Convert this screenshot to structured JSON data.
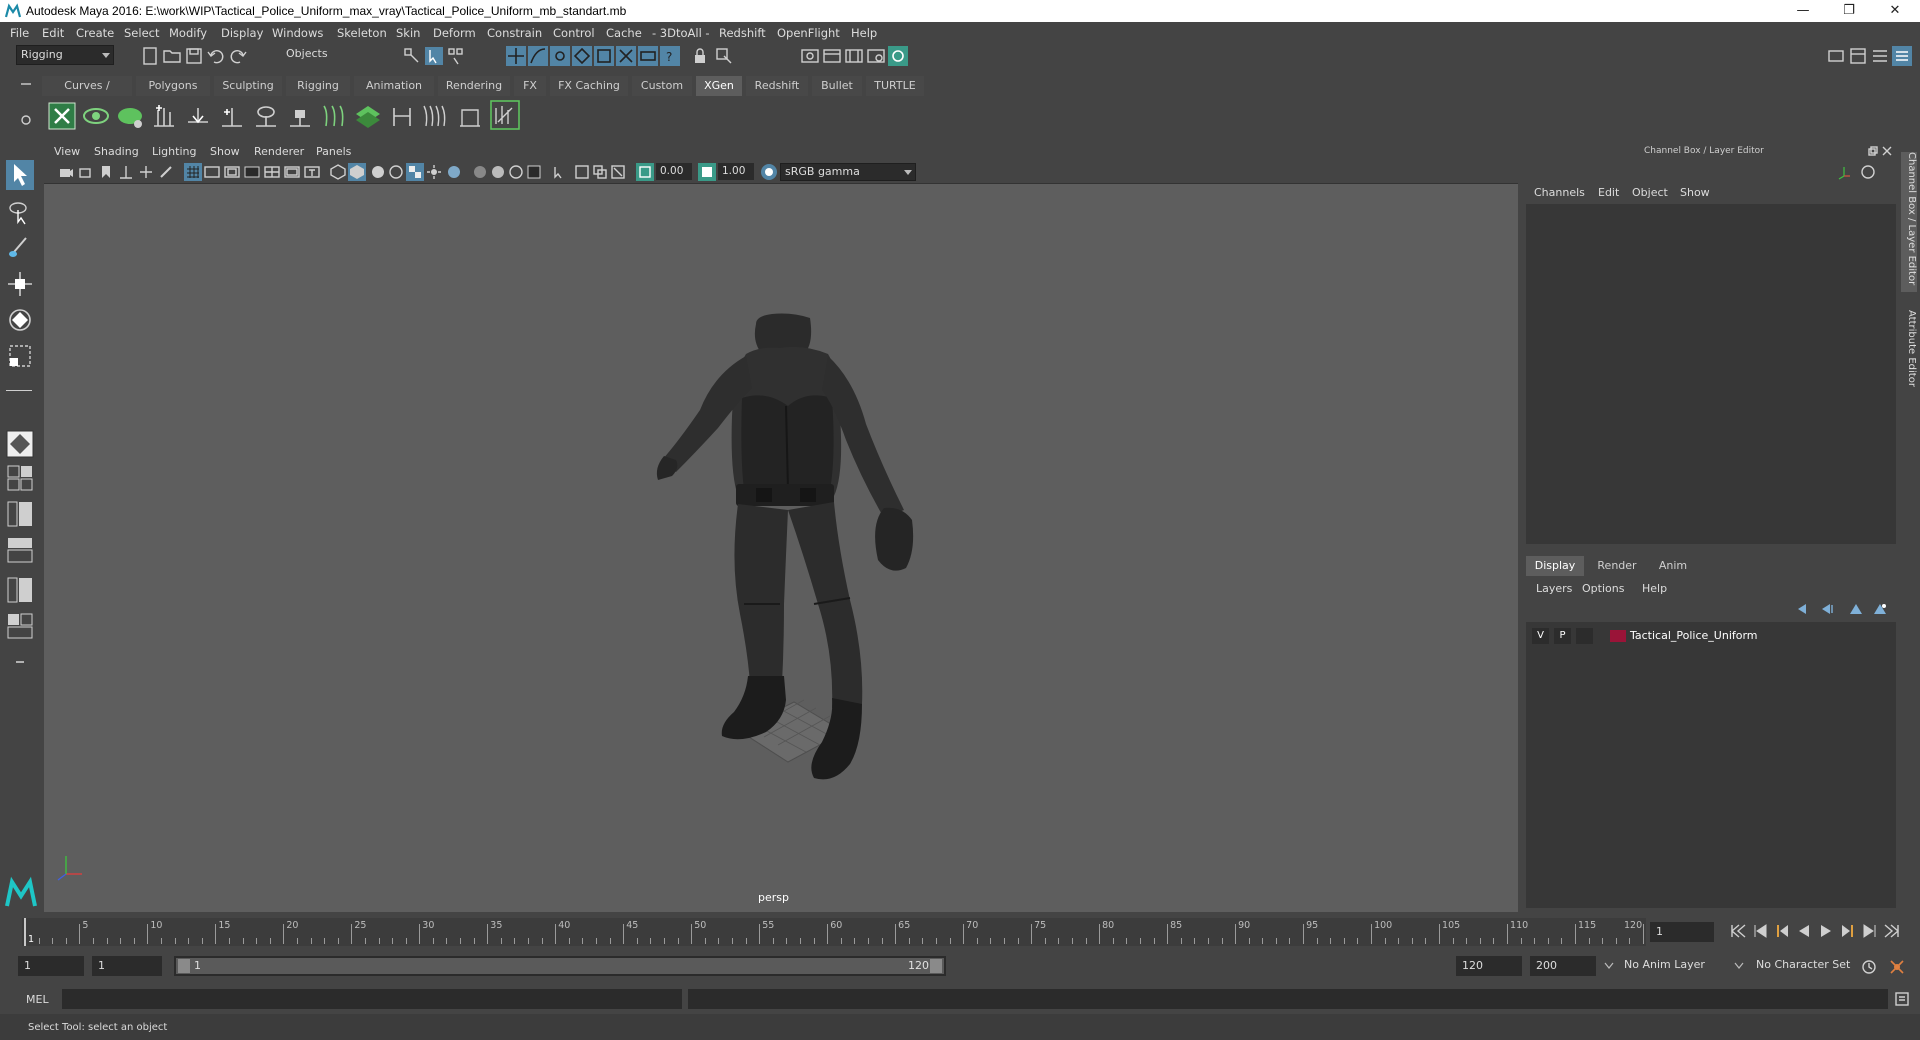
{
  "window": {
    "title": "Autodesk Maya 2016: E:\\work\\WIP\\Tactical_Police_Uniform_max_vray\\Tactical_Police_Uniform_mb_standart.mb",
    "minimize": "—",
    "restore": "❐",
    "close": "✕"
  },
  "menubar": {
    "items": [
      "File",
      "Edit",
      "Create",
      "Select",
      "Modify",
      "Display",
      "Windows",
      "Skeleton",
      "Skin",
      "Deform",
      "Constrain",
      "Control",
      "Cache",
      "- 3DtoAll -",
      "Redshift",
      "OpenFlight",
      "Help"
    ]
  },
  "statusline": {
    "menuset": "Rigging",
    "selection_mode": "Objects"
  },
  "shelf": {
    "tabs": [
      "Curves / Surfaces",
      "Polygons",
      "Sculpting",
      "Rigging",
      "Animation",
      "Rendering",
      "FX",
      "FX Caching",
      "Custom",
      "XGen",
      "Redshift",
      "Bullet",
      "TURTLE"
    ],
    "active_tab": "XGen"
  },
  "viewport": {
    "menu": [
      "View",
      "Shading",
      "Lighting",
      "Show",
      "Renderer",
      "Panels"
    ],
    "exposure": "0.00",
    "gamma": "1.00",
    "color_space": "sRGB gamma",
    "camera": "persp"
  },
  "channelbox": {
    "header": "Channel Box / Layer Editor",
    "menu": [
      "Channels",
      "Edit",
      "Object",
      "Show"
    ]
  },
  "layers": {
    "tabs": [
      "Display",
      "Render",
      "Anim"
    ],
    "active_tab": "Display",
    "menu": [
      "Layers",
      "Options",
      "Help"
    ],
    "rows": [
      {
        "v": "V",
        "p": "P",
        "name": "Tactical_Police_Uniform",
        "color": "#9a1438"
      }
    ]
  },
  "sidetabs": [
    "Channel Box / Layer Editor",
    "Attribute Editor"
  ],
  "timeslider": {
    "labels": [
      "1",
      "5",
      "10",
      "15",
      "20",
      "25",
      "30",
      "35",
      "40",
      "45",
      "50",
      "55",
      "60",
      "65",
      "70",
      "75",
      "80",
      "85",
      "90",
      "95",
      "100",
      "105",
      "110",
      "115",
      "120"
    ],
    "current_frame": "1"
  },
  "rangeslider": {
    "start": "1",
    "playback_start": "1",
    "range_start_label": "1",
    "range_end_label": "120",
    "playback_end": "120",
    "end": "200",
    "anim_layer": "No Anim Layer",
    "character_set": "No Character Set"
  },
  "commandline": {
    "label": "MEL"
  },
  "helpline": {
    "text": "Select Tool: select an object"
  },
  "colors": {
    "accent": "#5285a6",
    "layer_color": "#9a1438",
    "viewport_bg": "#5e5e5e"
  }
}
